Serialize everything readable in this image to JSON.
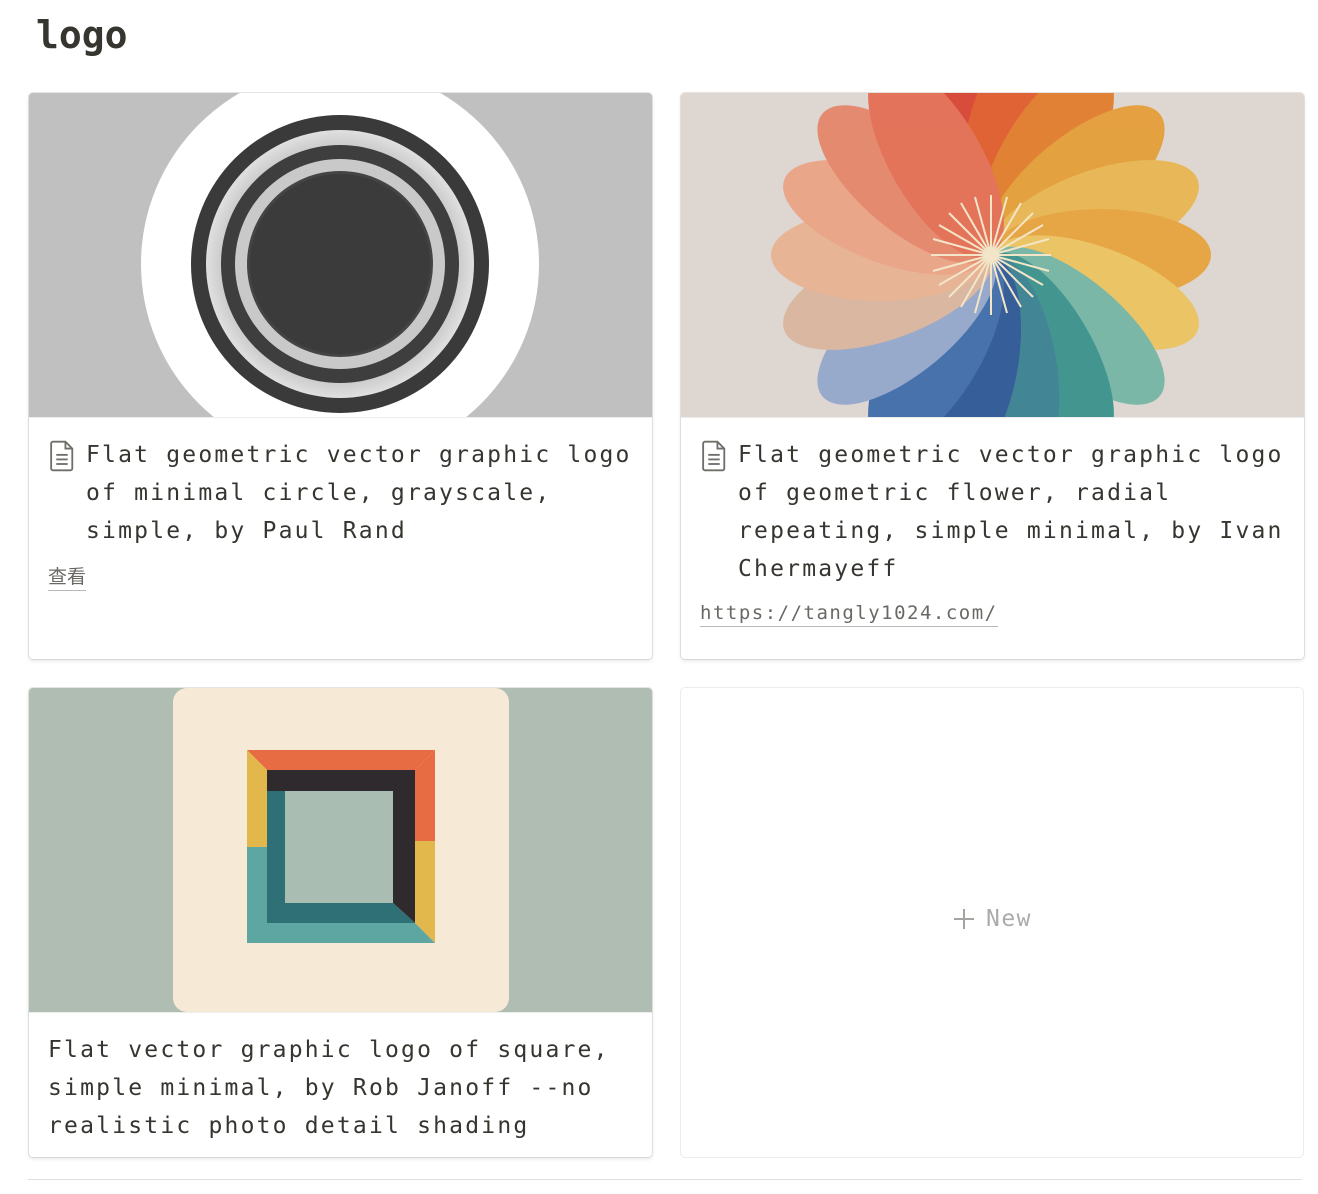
{
  "page": {
    "title": "logo"
  },
  "cards": [
    {
      "title": "Flat geometric vector graphic logo of minimal circle, grayscale, simple, by Paul Rand",
      "link": "查看",
      "has_icon": true,
      "cover": "grayscale concentric circles logo"
    },
    {
      "title": "Flat geometric vector graphic logo of geometric flower, radial repeating, simple minimal, by Ivan Chermayeff",
      "link": "https://tangly1024.com/",
      "has_icon": true,
      "cover": "multicolor radial geometric flower logo"
    },
    {
      "title": "Flat vector graphic logo of square, simple minimal, by Rob Janoff --no realistic photo detail shading",
      "has_icon": false,
      "cover": "colored square frame logo"
    }
  ],
  "new_card": {
    "label": "New"
  },
  "colors": {
    "text": "#37352f",
    "muted": "#9b9a97",
    "border": "#e9e9e7"
  }
}
